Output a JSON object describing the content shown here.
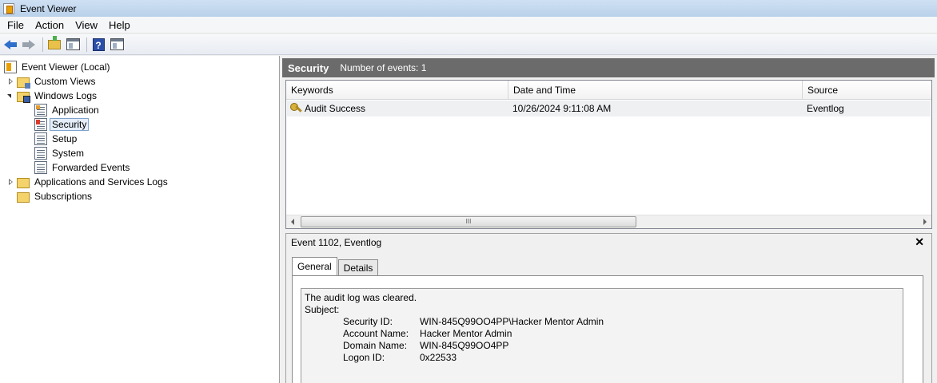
{
  "window": {
    "title": "Event Viewer"
  },
  "menu": [
    "File",
    "Action",
    "View",
    "Help"
  ],
  "toolbar": [
    {
      "name": "back-icon"
    },
    {
      "name": "forward-icon"
    },
    {
      "name": "up-folder-icon"
    },
    {
      "name": "show-hide-tree-icon"
    },
    {
      "name": "help-icon"
    },
    {
      "name": "show-hide-action-pane-icon"
    }
  ],
  "tree": {
    "root": "Event Viewer (Local)",
    "custom_views": "Custom Views",
    "windows_logs": "Windows Logs",
    "application": "Application",
    "security": "Security",
    "setup": "Setup",
    "system": "System",
    "forwarded_events": "Forwarded Events",
    "apps_services": "Applications and Services Logs",
    "subscriptions": "Subscriptions"
  },
  "header": {
    "title": "Security",
    "count": "Number of events: 1"
  },
  "grid": {
    "columns": [
      "Keywords",
      "Date and Time",
      "Source"
    ],
    "rows": [
      {
        "keywords": "Audit Success",
        "datetime": "10/26/2024 9:11:08 AM",
        "source": "Eventlog"
      }
    ],
    "scroll_grip": "III"
  },
  "detail": {
    "title": "Event 1102, Eventlog",
    "close": "✕",
    "tabs": [
      "General",
      "Details"
    ],
    "message": "The audit log was cleared.",
    "subject_label": "Subject:",
    "fields": [
      {
        "key": "Security ID:",
        "value": "WIN-845Q99OO4PP\\Hacker Mentor Admin"
      },
      {
        "key": "Account Name:",
        "value": "Hacker Mentor Admin"
      },
      {
        "key": "Domain Name:",
        "value": "WIN-845Q99OO4PP"
      },
      {
        "key": "Logon ID:",
        "value": "0x22533"
      }
    ]
  }
}
